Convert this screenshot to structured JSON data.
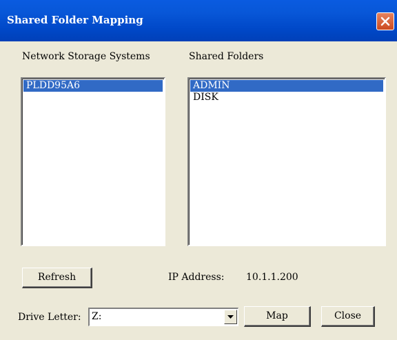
{
  "window": {
    "title": "Shared Folder Mapping"
  },
  "storage": {
    "label": "Network Storage Systems",
    "items": [
      {
        "label": "PLDD95A6",
        "selected": true
      }
    ]
  },
  "folders": {
    "label": "Shared Folders",
    "items": [
      {
        "label": "ADMIN",
        "selected": true
      },
      {
        "label": "DISK",
        "selected": false
      }
    ]
  },
  "actions": {
    "refresh_label": "Refresh",
    "map_label": "Map",
    "close_label": "Close"
  },
  "ip": {
    "label": "IP Address:",
    "value": "10.1.1.200"
  },
  "drive": {
    "label": "Drive Letter:",
    "value": "Z:"
  },
  "colors": {
    "title_bar": "#0a5be0",
    "selection": "#316ac5",
    "dialog_bg": "#ece9d8"
  },
  "icons": {
    "close": "close-icon",
    "dropdown": "dropdown-arrow-icon"
  }
}
